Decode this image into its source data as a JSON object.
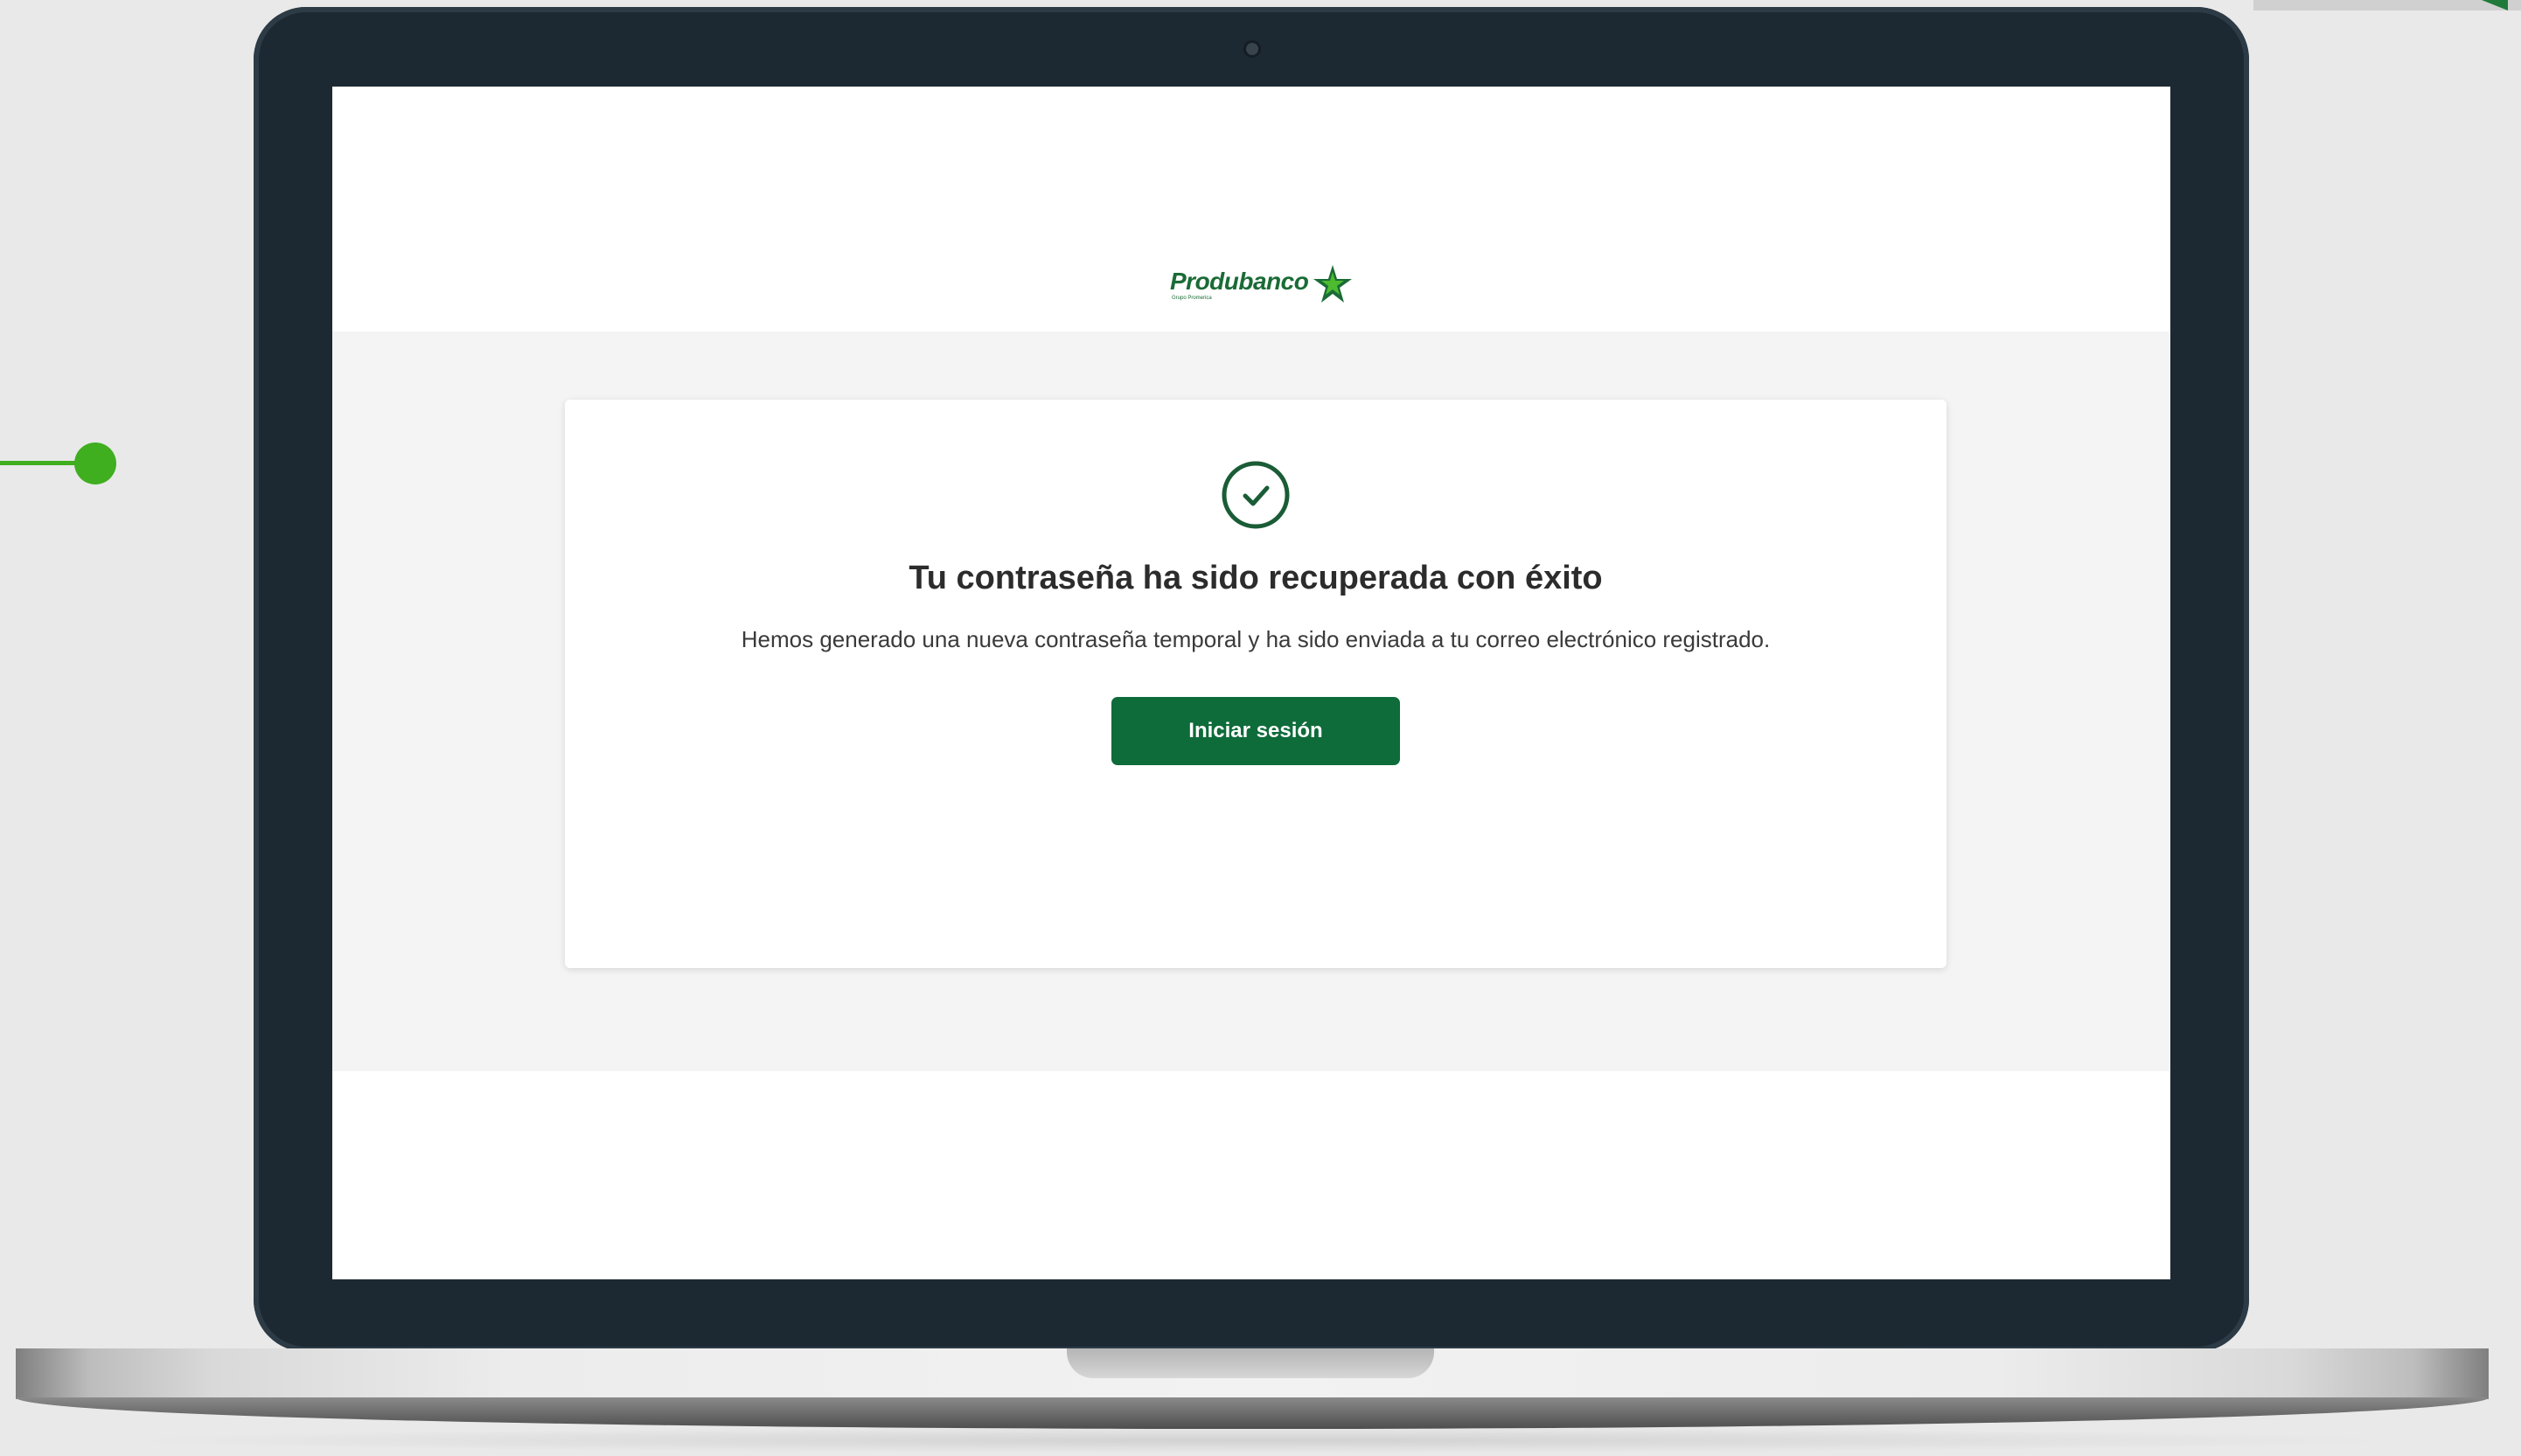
{
  "brand": {
    "name": "Produbanco",
    "tagline": "Grupo Promerica",
    "color": "#1a6b36"
  },
  "card": {
    "icon": "check-circle-icon",
    "title": "Tu contraseña ha sido recuperada con éxito",
    "message": "Hemos generado una nueva contraseña temporal y ha sido enviada a tu correo electrónico registrado.",
    "button_label": "Iniciar sesión",
    "button_color": "#0e6b3a"
  },
  "decor": {
    "accent_color": "#3fae1f",
    "device": "laptop"
  }
}
